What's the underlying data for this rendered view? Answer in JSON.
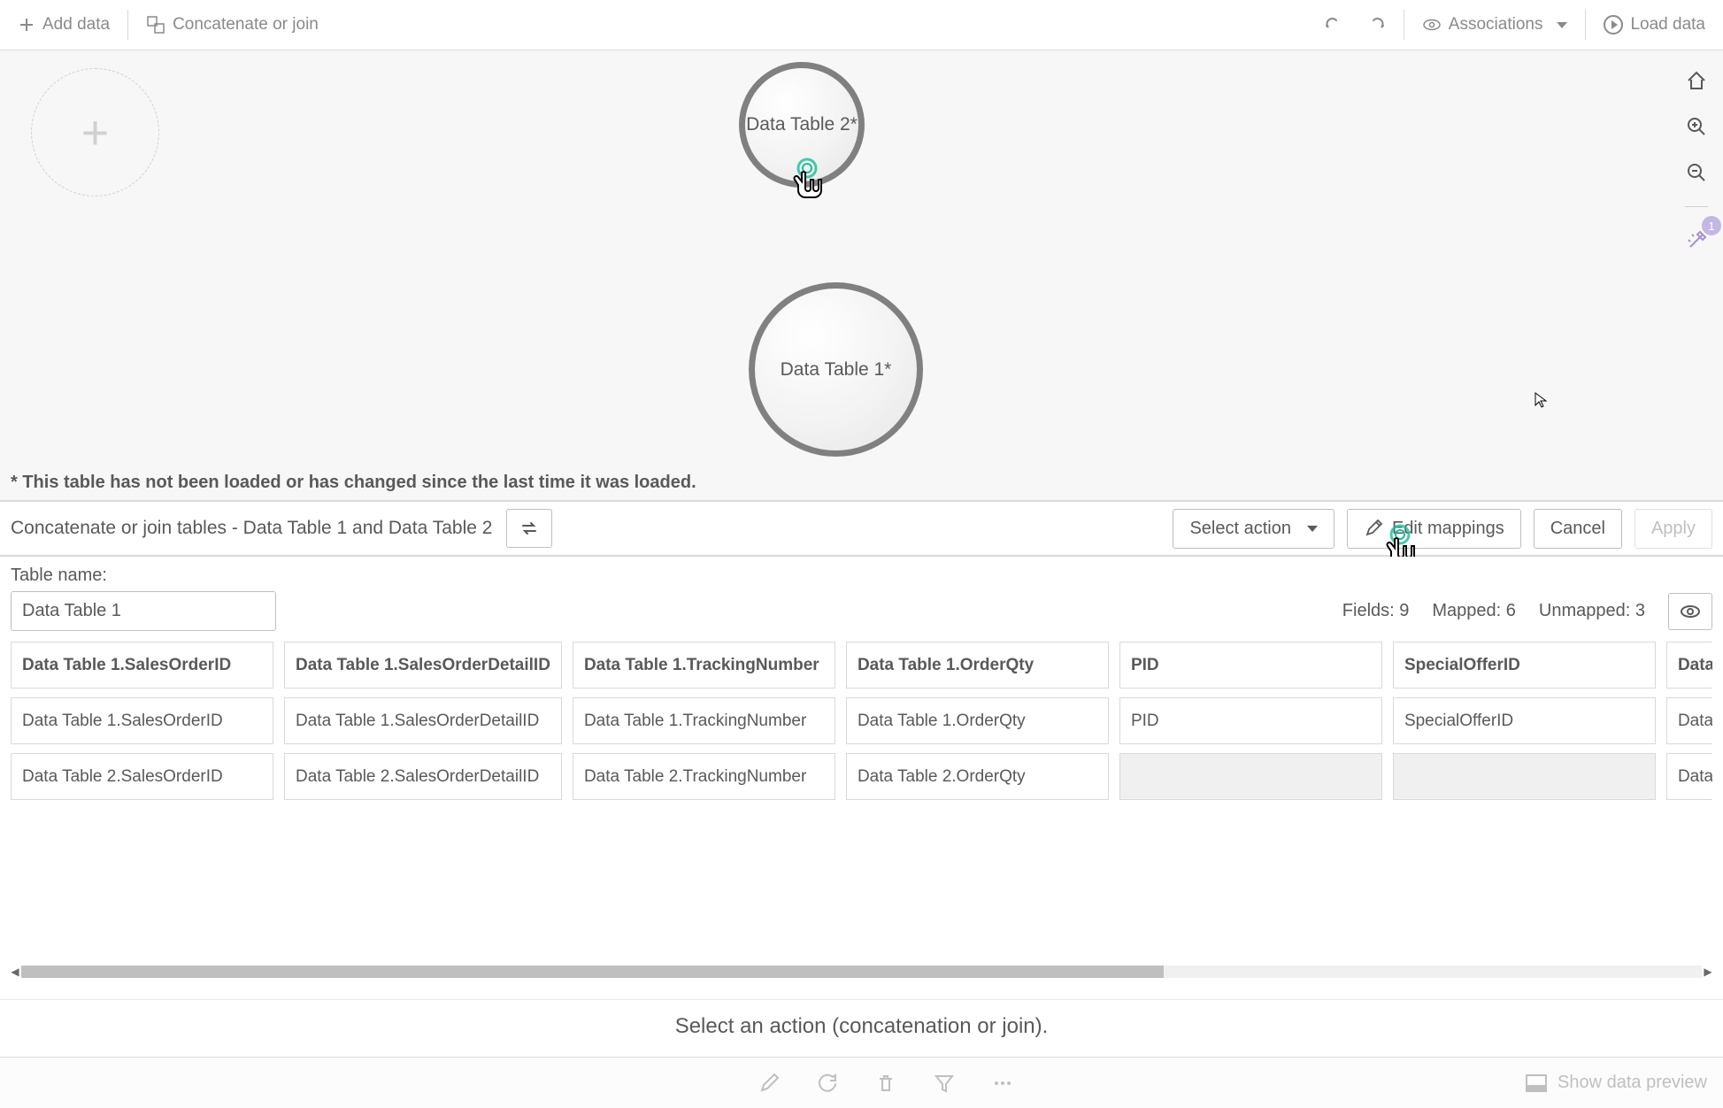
{
  "toolbar": {
    "add_data": "Add data",
    "concat_join": "Concatenate or join",
    "associations": "Associations",
    "load_data": "Load data"
  },
  "canvas": {
    "table_bubble_2": "Data Table 2*",
    "table_bubble_1": "Data Table 1*",
    "footnote": "* This table has not been loaded or has changed since the last time it was loaded."
  },
  "right_tools": {
    "badge_count": "1"
  },
  "panel": {
    "title": "Concatenate or join tables - Data Table 1 and Data Table 2",
    "select_action": "Select action",
    "edit_mappings": "Edit mappings",
    "cancel": "Cancel",
    "apply": "Apply"
  },
  "table_editor": {
    "name_label": "Table name:",
    "name_value": "Data Table 1",
    "fields_label": "Fields:",
    "fields_count": "9",
    "mapped_label": "Mapped:",
    "mapped_count": "6",
    "unmapped_label": "Unmapped:",
    "unmapped_count": "3"
  },
  "columns": [
    {
      "header": "Data Table 1.SalesOrderID",
      "rows": [
        "Data Table 1.SalesOrderID",
        "Data Table 2.SalesOrderID"
      ]
    },
    {
      "header": "Data Table 1.SalesOrderDetailID",
      "rows": [
        "Data Table 1.SalesOrderDetailID",
        "Data Table 2.SalesOrderDetailID"
      ]
    },
    {
      "header": "Data Table 1.TrackingNumber",
      "rows": [
        "Data Table 1.TrackingNumber",
        "Data Table 2.TrackingNumber"
      ]
    },
    {
      "header": "Data Table 1.OrderQty",
      "rows": [
        "Data Table 1.OrderQty",
        "Data Table 2.OrderQty"
      ]
    },
    {
      "header": "PID",
      "rows": [
        "PID",
        ""
      ]
    },
    {
      "header": "SpecialOfferID",
      "rows": [
        "SpecialOfferID",
        ""
      ]
    },
    {
      "header": "Data Ta",
      "rows": [
        "Data Ta",
        "Data Ta"
      ]
    }
  ],
  "instruction": "Select an action (concatenation or join).",
  "bottom": {
    "show_preview": "Show data preview"
  }
}
